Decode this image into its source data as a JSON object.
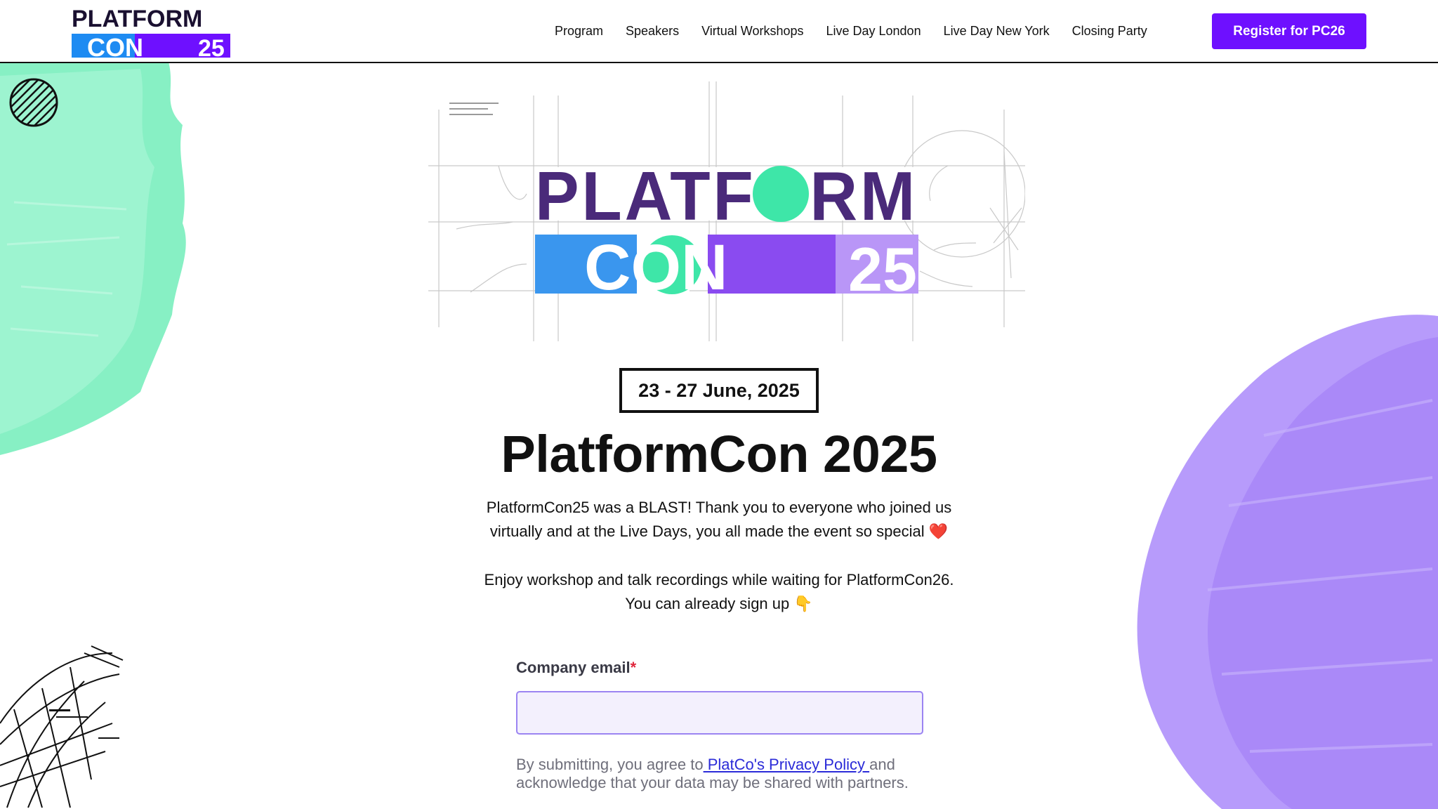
{
  "brand": {
    "logo_top": "PLATFORM",
    "logo_bottom": "CON",
    "logo_year": "25",
    "colors": {
      "purple": "#6e10ff",
      "green": "#3ee6a8",
      "blue": "#1e8bf2",
      "dark": "#2a1a4a"
    }
  },
  "nav": {
    "items": [
      "Program",
      "Speakers",
      "Virtual Workshops",
      "Live Day London",
      "Live Day New York",
      "Closing Party"
    ],
    "register_label": "Register for PC26"
  },
  "hero": {
    "logo_top": "PLATFORM",
    "logo_bottom": "CON",
    "logo_year": "25"
  },
  "event": {
    "date": "23 - 27 June, 2025",
    "title": "PlatformCon 2025",
    "para1_line1": "PlatformCon25 was a BLAST! Thank you to everyone who joined us",
    "para1_line2": "virtually and at the Live Days, you all made the event so special ❤️",
    "para2_line1": "Enjoy workshop and talk recordings while waiting for PlatformCon26.",
    "para2_line2": "You can already sign up 👇"
  },
  "form": {
    "email_label": "Company email",
    "required_mark": "*",
    "email_value": "",
    "email_placeholder": "",
    "disclaimer_prefix": "By submitting, you agree to",
    "privacy_link": " PlatCo's Privacy Policy ",
    "disclaimer_suffix": "and acknowledge that your data may be shared with partners."
  },
  "icons": {
    "hatch": "hatched-circle-icon",
    "sketch": "sketch-drawing-icon"
  }
}
